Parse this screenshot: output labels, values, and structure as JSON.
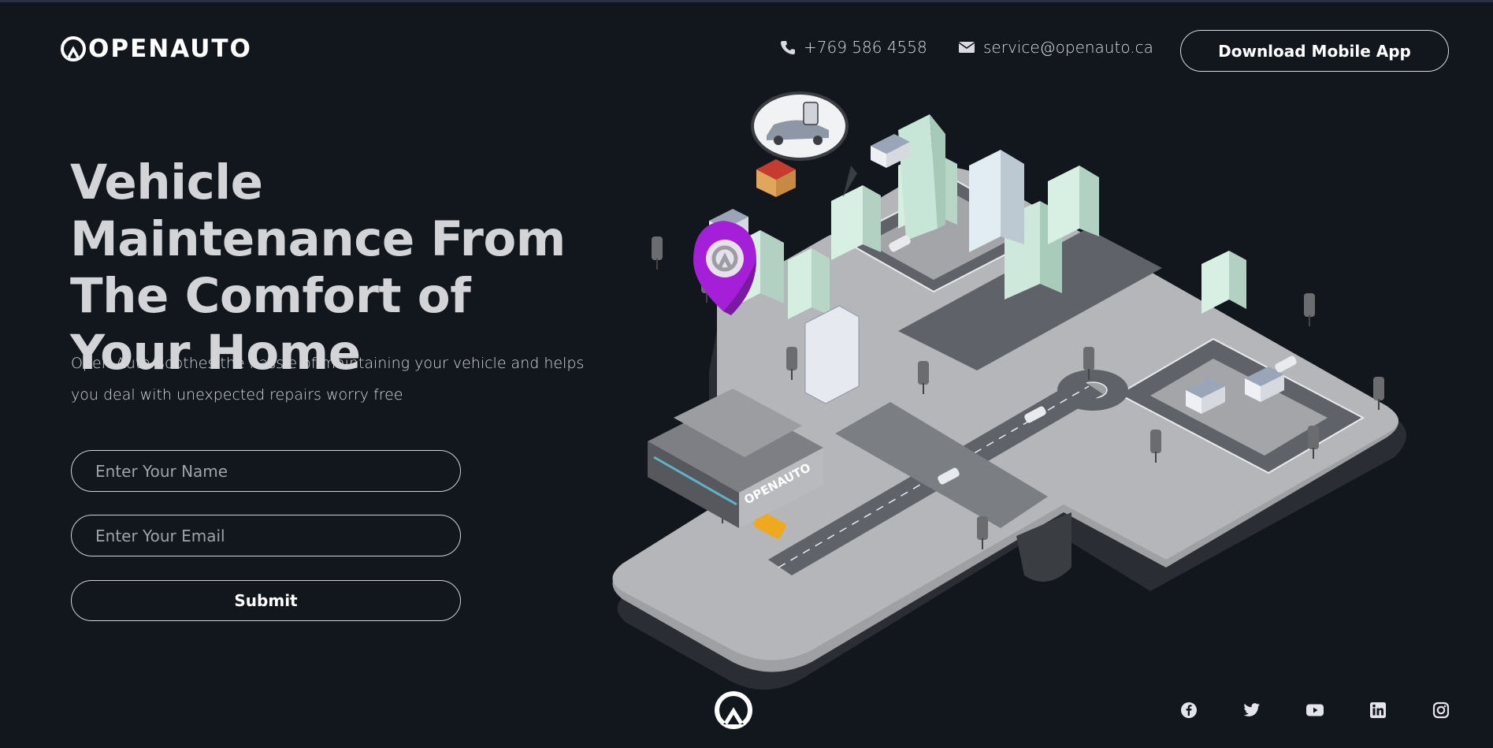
{
  "brand": {
    "name": "OPENAUTO",
    "accent": "#a61fd8"
  },
  "header": {
    "phone_icon": "phone-icon",
    "phone": "+769 586 4558",
    "email_icon": "mail-icon",
    "email": "service@openauto.ca",
    "download_label": "Download Mobile App"
  },
  "hero": {
    "title": "Vehicle Maintenance From The Comfort of Your Home",
    "subtitle": "Open Auto Soothes the hassle of maintaining your vehicle and helps you deal with unexpected repairs worry free"
  },
  "form": {
    "name_placeholder": "Enter Your Name",
    "email_placeholder": "Enter Your Email",
    "submit_label": "Submit"
  },
  "illustration": {
    "sign_text": "OPENAUTO"
  },
  "footer": {
    "social": [
      "facebook-icon",
      "twitter-icon",
      "youtube-icon",
      "linkedin-icon",
      "instagram-icon"
    ]
  },
  "colors": {
    "background": "#12161d",
    "text": "#d3d4d8",
    "border": "#d0d2d7"
  }
}
